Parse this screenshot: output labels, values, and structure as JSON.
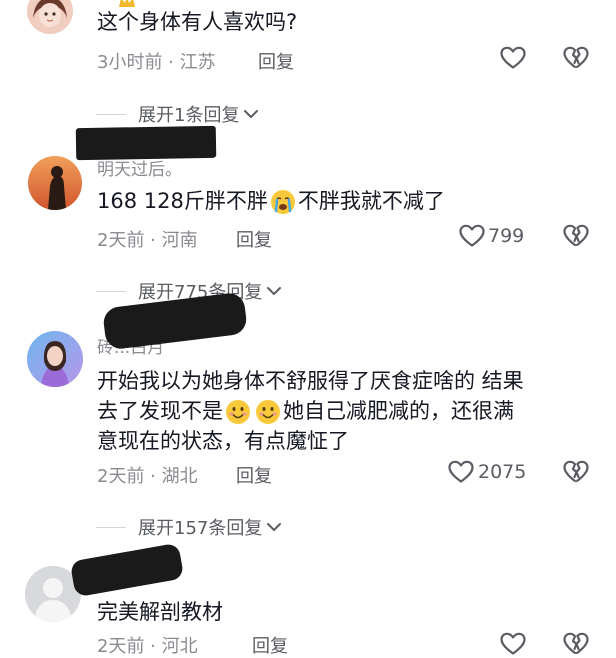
{
  "comments": [
    {
      "text": "这个身体有人喜欢吗?",
      "meta": "3小时前 · 江苏",
      "reply_label": "回复"
    },
    {
      "username": "明天过后。",
      "text_parts": [
        "168    128斤胖不胖",
        "不胖我就不减了"
      ],
      "meta": "2天前 · 河南",
      "reply_label": "回复",
      "like_count": "799"
    },
    {
      "username": "砖...白月",
      "text_lines": [
        "开始我以为她身体不舒服得了厌食症啥的  结果",
        "她自己减肥减的，还很满",
        "意现在的状态，有点魔怔了"
      ],
      "text_line2_prefix": "去了发现不是",
      "meta": "2天前 · 湖北",
      "reply_label": "回复",
      "like_count": "2075"
    },
    {
      "text": "完美解剖教材",
      "meta": "2天前 · 河北",
      "reply_label": "回复"
    }
  ],
  "expand_replies": [
    {
      "label": "展开1条回复"
    },
    {
      "label": "展开775条回复"
    },
    {
      "label": "展开157条回复"
    }
  ],
  "icons": {
    "like": "heart-outline-icon",
    "dislike": "broken-heart-icon",
    "expand": "chevron-down-icon",
    "crying": "crying-emoji-icon",
    "smiling": "smiling-emoji-icon"
  },
  "colors": {
    "text": "#161823",
    "muted": "#8a8b91",
    "secondary": "#5a5c63"
  }
}
